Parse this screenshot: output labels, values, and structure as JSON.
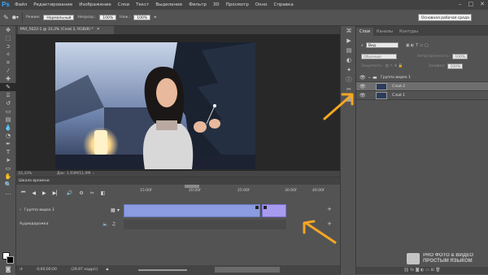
{
  "menubar": {
    "logo": "Ps",
    "items": [
      "Файл",
      "Редактирование",
      "Изображение",
      "Слои",
      "Текст",
      "Выделение",
      "Фильтр",
      "3D",
      "Просмотр",
      "Окно",
      "Справка"
    ]
  },
  "options": {
    "mode_label": "Режим:",
    "mode_value": "Нормальный",
    "opacity_label": "Непрозр.:",
    "opacity_value": "100%",
    "flow_label": "Наж.:",
    "flow_value": "100%",
    "workspace": "Основная рабочая среда"
  },
  "document": {
    "tab_title": "MVI_5622-1 @ 33,3% (Слой 2, RGB/8) *",
    "zoom": "33,33%",
    "doc_size": "Док: 1,93M/11,9M"
  },
  "timeline": {
    "title": "Шкала времени",
    "ruler_labels": [
      "15:00f",
      "20:00f",
      "25:00f",
      "30:00f",
      "40:00f"
    ],
    "video_group_label": "Группа видео 1",
    "audio_label": "Аудиодорожка",
    "timecode": "0;00;00;00",
    "fps": "(29,97 кадр/с)"
  },
  "layers": {
    "tabs": [
      "Слои",
      "Каналы",
      "Контуры"
    ],
    "filter_label": "Вид",
    "blend_mode": "Обычные",
    "opacity_label": "Непрозрачность:",
    "opacity_value": "100%",
    "lock_label": "Закрепить:",
    "fill_label": "Заливка:",
    "fill_value": "100%",
    "group_name": "Группа видео 1",
    "layer2": "Слой 2",
    "layer1": "Слой 1"
  },
  "watermark": {
    "line1": "PRO ФОТО & ВИДЕО",
    "line2": "ПРОСТЫМ ЯЗЫКОМ"
  },
  "colors": {
    "clip_main": "#8b9ce0",
    "clip_short": "#a79bf0",
    "arrow": "#f5a623",
    "ps_blue": "#31a8ff"
  }
}
